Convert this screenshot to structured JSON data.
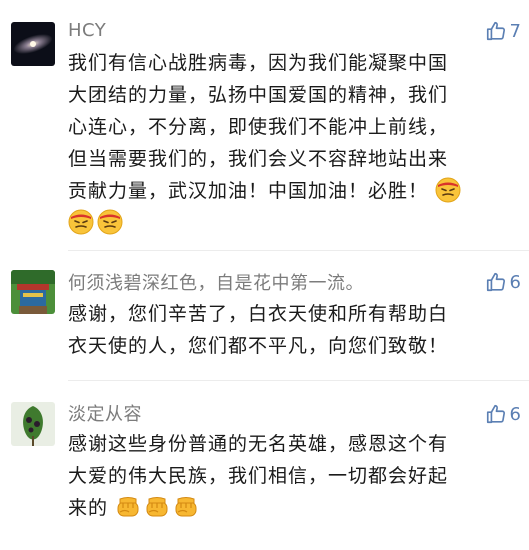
{
  "comments": [
    {
      "author": "HCY",
      "likes": "7",
      "lines": [
        "我们有信心战胜病毒，因为我们能凝聚中国",
        "大团结的力量，弘扬中国爱国的精神，我们",
        "心连心，不分离，即使我们不能冲上前线，",
        "但当需要我们的，我们会义不容辞地站出来",
        "贡献力量，武汉加油！中国加油！必胜！"
      ],
      "emoji": [
        "determined-face-emoji",
        "determined-face-emoji",
        "determined-face-emoji"
      ]
    },
    {
      "author": "何须浅碧深红色，自是花中第一流。",
      "likes": "6",
      "lines": [
        "感谢，您们辛苦了，白衣天使和所有帮助白",
        "衣天使的人，您们都不平凡，向您们致敬！"
      ]
    },
    {
      "author": "淡定从容",
      "likes": "6",
      "lines": [
        "感谢这些身份普通的无名英雄，感恩这个有",
        "大爱的伟大民族，我们相信，一切都会好起",
        "来的"
      ],
      "emoji": [
        "fist-emoji",
        "fist-emoji",
        "fist-emoji"
      ]
    }
  ],
  "colors": {
    "like_blue": "#5b7fb3",
    "author_gray": "#7c7c7c",
    "text": "#1b1b1b"
  }
}
